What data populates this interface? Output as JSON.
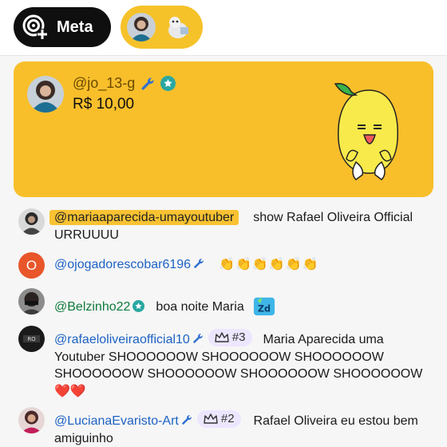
{
  "topbar": {
    "meta_label": "Meta",
    "meta_icon": "add-channel-icon"
  },
  "superchat": {
    "handle": "@jo_13-g",
    "amount": "R$ 10,00",
    "color": "#f8bf2b"
  },
  "messages": [
    {
      "author": "@mariaaparecida-umayoutuber",
      "text": "show Rafael Oliveira Official URRUUUU"
    },
    {
      "avatar_letter": "O",
      "author": "@ojogadorescobar6196",
      "text": "👏👏👏👏👏👏"
    },
    {
      "author": "@Belzinho22",
      "text": "boa noite Maria"
    },
    {
      "author": "@rafaeloliveiraofficial10",
      "rank": "#3",
      "text": "Maria Aparecida uma Youtuber SHOOOOOOW SHOOOOOOW SHOOOOOOW SHOOOOOOW SHOOOOOOW SHOOOOOOW SHOOOOOOW ❤️❤️"
    },
    {
      "author": "@LucianaEvaristo-Art",
      "rank": "#2",
      "text": "Rafael Oliveira eu estou bem amiguinho"
    }
  ],
  "colors": {
    "author_link": "#1d62c4",
    "highlight": "#f8c232",
    "rank_bg": "#ede6ff"
  }
}
